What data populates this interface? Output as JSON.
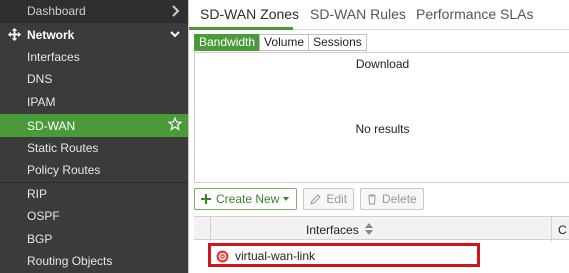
{
  "sidebar": {
    "dashboard": "Dashboard",
    "network": "Network",
    "items": [
      {
        "label": "Interfaces"
      },
      {
        "label": "DNS"
      },
      {
        "label": "IPAM"
      },
      {
        "label": "SD-WAN"
      },
      {
        "label": "Static Routes"
      },
      {
        "label": "Policy Routes"
      },
      {
        "label": "RIP"
      },
      {
        "label": "OSPF"
      },
      {
        "label": "BGP"
      },
      {
        "label": "Routing Objects"
      }
    ]
  },
  "tabs": {
    "zones": "SD-WAN Zones",
    "rules": "SD-WAN Rules",
    "slas": "Performance SLAs"
  },
  "subtabs": {
    "bandwidth": "Bandwidth",
    "volume": "Volume",
    "sessions": "Sessions"
  },
  "chart": {
    "title": "Download",
    "empty": "No results"
  },
  "toolbar": {
    "create": "Create New",
    "edit": "Edit",
    "delete": "Delete"
  },
  "table": {
    "column_interfaces": "Interfaces",
    "column_next": "C",
    "rows": [
      {
        "name": "virtual-wan-link"
      }
    ]
  },
  "colors": {
    "accent": "#4a9a3a",
    "highlight": "#d0141e"
  }
}
